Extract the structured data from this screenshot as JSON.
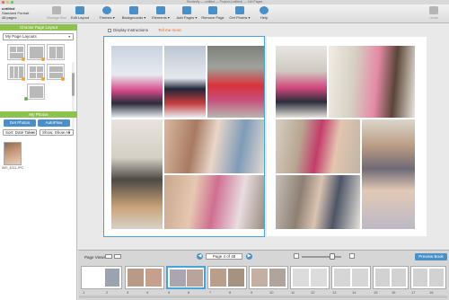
{
  "window": {
    "title": "Shutterfly — untitled — Project (untitled) — 146 Pages",
    "colors": {
      "close": "#ec5f57",
      "minimize": "#f4be4f",
      "zoom": "#62c654"
    }
  },
  "project": {
    "name": "untitled",
    "subtitle": "Standard Portrait",
    "pages": "48 pages"
  },
  "toolbar": {
    "items": [
      {
        "label": "Storage Box",
        "icon": "storage-icon",
        "enabled": false
      },
      {
        "label": "Edit Layout",
        "icon": "layout-icon",
        "enabled": true
      },
      {
        "label": "Themes ▾",
        "icon": "themes-icon",
        "enabled": true
      },
      {
        "label": "Backgrounds ▾",
        "icon": "backgrounds-icon",
        "enabled": true
      },
      {
        "label": "Elements ▾",
        "icon": "elements-icon",
        "enabled": true
      },
      {
        "label": "Add Pages ▾",
        "icon": "add-pages-icon",
        "enabled": true
      },
      {
        "label": "Remove Page",
        "icon": "remove-page-icon",
        "enabled": true
      },
      {
        "label": "Get Photos ▾",
        "icon": "get-photos-icon",
        "enabled": true
      },
      {
        "label": "Help",
        "icon": "help-icon",
        "enabled": true
      },
      {
        "label": "Undo",
        "icon": "undo-icon",
        "enabled": false
      }
    ]
  },
  "sidebar": {
    "layouts_header": "Choose Page Layout",
    "layouts_dropdown": "My Page Layouts",
    "photos_header": "My Photos",
    "get_photos_label": "Get Photos",
    "autoflow_label": "AutoFlow",
    "sort_dropdown": "Sort: Date Taken",
    "show_dropdown": "Show: Show All",
    "photo_caption": "IMG_4021.JPG"
  },
  "main": {
    "display_instructions_label": "Display Instructions",
    "tell_me_more_label": "Tell me more"
  },
  "bottom": {
    "page_views_label": "Page Views",
    "page_indicator": "Page 4 of 48",
    "preview_label": "Preview Book",
    "spread_numbers": [
      "1",
      "2",
      "3",
      "4",
      "5",
      "6",
      "7",
      "8",
      "9",
      "10",
      "11",
      "12",
      "13",
      "14",
      "15",
      "16",
      "17",
      "18",
      "19",
      "20",
      "21",
      "22"
    ]
  },
  "colors": {
    "accent": "#4a90c8",
    "selection": "#45a3e0",
    "panel_header": "#8ec24f",
    "link": "#e06a2a"
  }
}
